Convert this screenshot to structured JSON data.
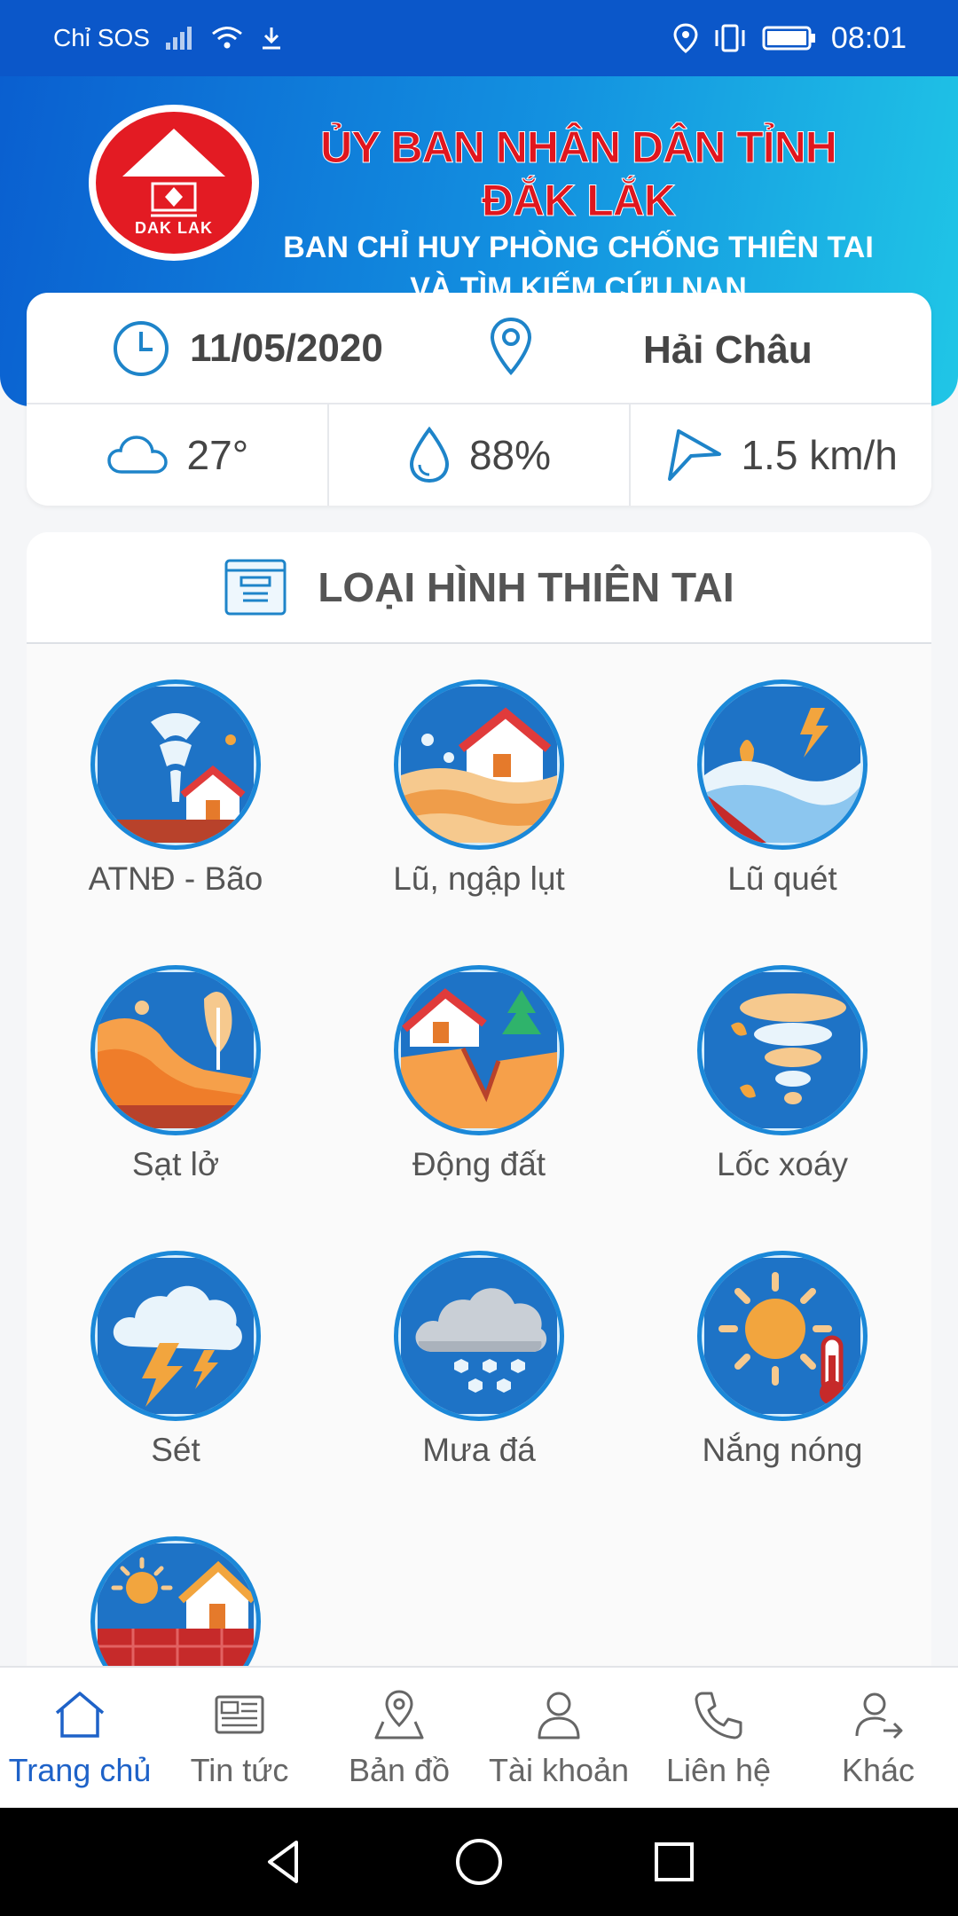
{
  "status_bar": {
    "carrier": "Chỉ SOS",
    "time": "08:01"
  },
  "header": {
    "logo_text": "DAK LAK",
    "title_line1": "ỦY BAN NHÂN DÂN TỈNH ĐẮK LẮK",
    "title_line2": "BAN CHỈ HUY PHÒNG CHỐNG THIÊN TAI",
    "title_line3": "VÀ TÌM KIẾM CỨU NẠN"
  },
  "info": {
    "date": "11/05/2020",
    "location": "Hải Châu",
    "temperature": "27°",
    "humidity": "88%",
    "wind": "1.5 km/h"
  },
  "categories": {
    "title": "LOẠI HÌNH THIÊN TAI",
    "items": [
      {
        "label": "ATNĐ - Bão",
        "icon": "storm-icon"
      },
      {
        "label": "Lũ, ngập lụt",
        "icon": "flood-icon"
      },
      {
        "label": "Lũ quét",
        "icon": "flash-flood-icon"
      },
      {
        "label": "Sạt lở",
        "icon": "landslide-icon"
      },
      {
        "label": "Động đất",
        "icon": "earthquake-icon"
      },
      {
        "label": "Lốc xoáy",
        "icon": "tornado-icon"
      },
      {
        "label": "Sét",
        "icon": "lightning-icon"
      },
      {
        "label": "Mưa đá",
        "icon": "hail-icon"
      },
      {
        "label": "Nắng nóng",
        "icon": "heat-icon"
      },
      {
        "label": "",
        "icon": "drought-icon"
      }
    ]
  },
  "bottom_nav": {
    "items": [
      {
        "label": "Trang chủ",
        "icon": "home-icon",
        "active": true
      },
      {
        "label": "Tin tức",
        "icon": "news-icon"
      },
      {
        "label": "Bản đồ",
        "icon": "map-icon"
      },
      {
        "label": "Tài khoản",
        "icon": "account-icon"
      },
      {
        "label": "Liên hệ",
        "icon": "phone-icon"
      },
      {
        "label": "Khác",
        "icon": "more-icon"
      }
    ]
  },
  "colors": {
    "primary": "#1e62c8",
    "status_bar": "#0b57c9",
    "title_red": "#e0161e"
  }
}
